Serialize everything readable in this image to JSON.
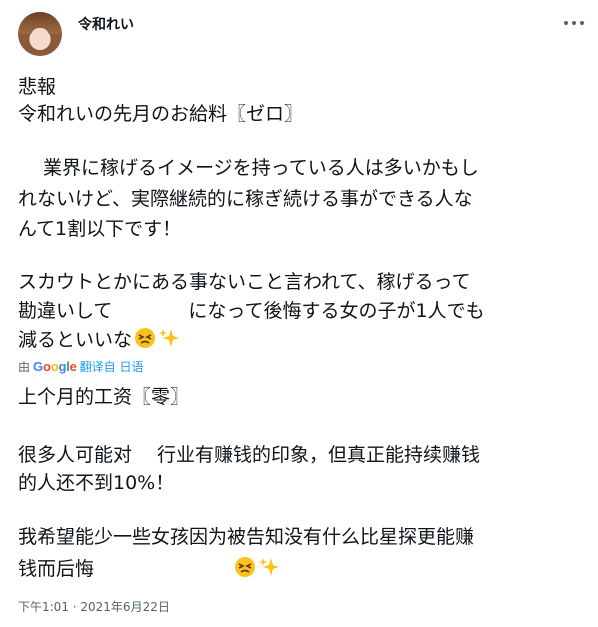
{
  "author": {
    "name": "令和れい"
  },
  "tweet": {
    "lines": [
      "悲報",
      "令和れいの先月のお給料〖ゼロ〗",
      "",
      "　 業界に稼げるイメージを持っている人は多いかもし",
      "れないけど、実際継続的に稼ぎ続ける事ができる人な",
      "んて1割以下です！",
      "",
      "スカウトとかにある事ないこと言われて、稼げるって",
      "勘違いして　　　　になって後悔する女の子が1人でも",
      "減るといいな"
    ]
  },
  "translation": {
    "prefix": "由",
    "provider": "Google",
    "link_label": "翻译自 日语",
    "lines": [
      "上个月的工资〖零〗",
      "",
      "很多人可能对　 行业有赚钱的印象，但真正能持续赚钱",
      "的人还不到10%！",
      "",
      "我希望能少一些女孩因为被告知没有什么比星探更能赚",
      "钱而后悔"
    ]
  },
  "timestamp": "下午1:01 · 2021年6月22日",
  "icons": {
    "more": "more-horizontal-icon",
    "emoji_1": "persevering-face-emoji",
    "emoji_2": "sparkles-emoji"
  },
  "colors": {
    "text": "#0f1419",
    "muted": "#536471",
    "link": "#1d9bf0"
  }
}
